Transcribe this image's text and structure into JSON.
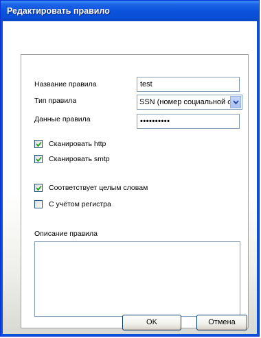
{
  "window": {
    "title": "Редактировать правило"
  },
  "form": {
    "name_label": "Название правила",
    "name_value": "test",
    "type_label": "Тип правила",
    "type_value": "SSN (номер социальной с",
    "data_label": "Данные правила",
    "data_value": "••••••••••",
    "scan_http_label": "Сканировать http",
    "scan_http_checked": true,
    "scan_smtp_label": "Сканировать smtp",
    "scan_smtp_checked": true,
    "whole_words_label": "Соответствует целым словам",
    "whole_words_checked": true,
    "case_label": "С учётом регистра",
    "case_checked": false,
    "description_label": "Описание правила",
    "description_value": ""
  },
  "buttons": {
    "ok": "OK",
    "cancel": "Отмена"
  },
  "colors": {
    "title_bar": "#0b53dc",
    "frame": "#0831d9",
    "field_border": "#7f9db9"
  }
}
